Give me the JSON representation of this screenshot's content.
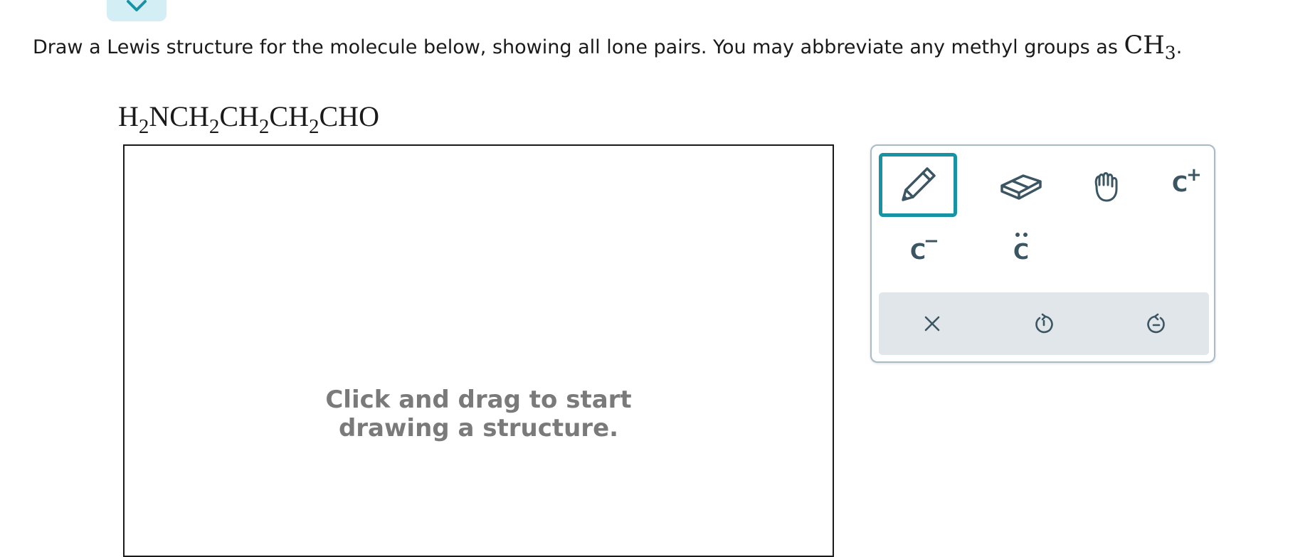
{
  "instruction": {
    "text": "Draw a Lewis structure for the molecule below, showing all lone pairs. You may abbreviate any methyl groups as ",
    "formula_main": "CH",
    "formula_sub": "3",
    "period": "."
  },
  "molecule": {
    "parts": [
      "H",
      "2",
      "NCH",
      "2",
      "CH",
      "2",
      "CH",
      "2",
      "CHO"
    ]
  },
  "canvas": {
    "hint_line1": "Click and drag to start",
    "hint_line2": "drawing a structure."
  },
  "toolbar": {
    "tools": [
      {
        "name": "pencil",
        "icon": "pencil-icon",
        "selected": true
      },
      {
        "name": "eraser",
        "icon": "eraser-icon",
        "selected": false
      },
      {
        "name": "move",
        "icon": "hand-icon",
        "selected": false
      },
      {
        "name": "positive-charge",
        "icon": "carbon-plus-icon",
        "label": "C",
        "superscript": "+"
      },
      {
        "name": "negative-charge",
        "icon": "carbon-minus-icon",
        "label": "C",
        "superscript": "−"
      },
      {
        "name": "lone-pair",
        "icon": "carbon-lone-pair-icon",
        "label": "C"
      }
    ],
    "actions": [
      {
        "name": "clear",
        "icon": "close-icon"
      },
      {
        "name": "undo",
        "icon": "undo-icon"
      },
      {
        "name": "redo",
        "icon": "redo-icon"
      }
    ],
    "accent_color": "#1893a3",
    "icon_color": "#3b5563"
  }
}
